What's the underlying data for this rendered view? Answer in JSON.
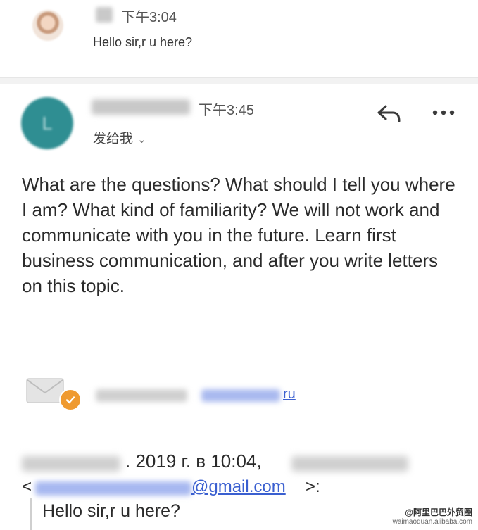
{
  "thread": {
    "message_1": {
      "time": "下午3:04",
      "preview": "Hello sir,r u here?"
    },
    "message_2": {
      "avatar_initial": "L",
      "time": "下午3:45",
      "recipient_label": "发给我",
      "recipient_chevron": "⌄",
      "reply_icon": "reply-icon",
      "more_icon": "more-icon",
      "body": "What are the questions? What should I tell you where I am? What kind of familiarity? We will not work and communicate with you in the future. Learn first business communication, and after you write letters on this topic."
    }
  },
  "quoted": {
    "signature_link_tld": "ru",
    "date_text": ". 2019 г. в 10:04,",
    "email_open": "<",
    "email_domain": "@gmail.com",
    "email_close": ">:",
    "quoted_text": "Hello sir,r u here?"
  },
  "watermark": {
    "line1": "@阿里巴巴外贸圈",
    "line2": "waimaoquan.alibaba.com"
  },
  "colors": {
    "avatar_teal": "#2f8e92",
    "badge_orange": "#ef9a30",
    "link_blue": "#3a5fd0"
  }
}
